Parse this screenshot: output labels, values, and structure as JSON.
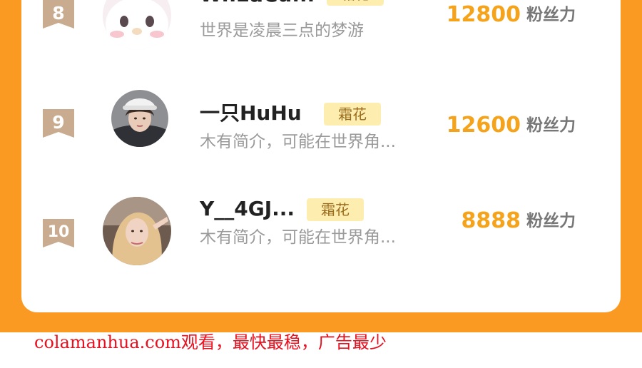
{
  "ranking": {
    "rows": [
      {
        "rank": "8",
        "name": "WhEaCu...",
        "tag": "霜花",
        "bio": "世界是凌晨三点的梦游",
        "score": "12800",
        "score_unit": "粉丝力",
        "avatar_icon": "hello-kitty-avatar-icon"
      },
      {
        "rank": "9",
        "name": "一只HuHu",
        "tag": "霜花",
        "bio": "木有简介，可能在世界角...",
        "score": "12600",
        "score_unit": "粉丝力",
        "avatar_icon": "user-photo-avatar-icon"
      },
      {
        "rank": "10",
        "name": "Y__4GJ...",
        "tag": "霜花",
        "bio": "木有简介，可能在世界角...",
        "score": "8888",
        "score_unit": "粉丝力",
        "avatar_icon": "user-photo-avatar-icon"
      }
    ]
  },
  "watermark": {
    "text": "colamanhua.com观看，最快最稳，广告最少"
  },
  "colors": {
    "frame": "#fb9a22",
    "badge": "#c9ab90",
    "score": "#f5a31a",
    "tag_bg": "#fdeeb0",
    "watermark": "#e8101f"
  }
}
